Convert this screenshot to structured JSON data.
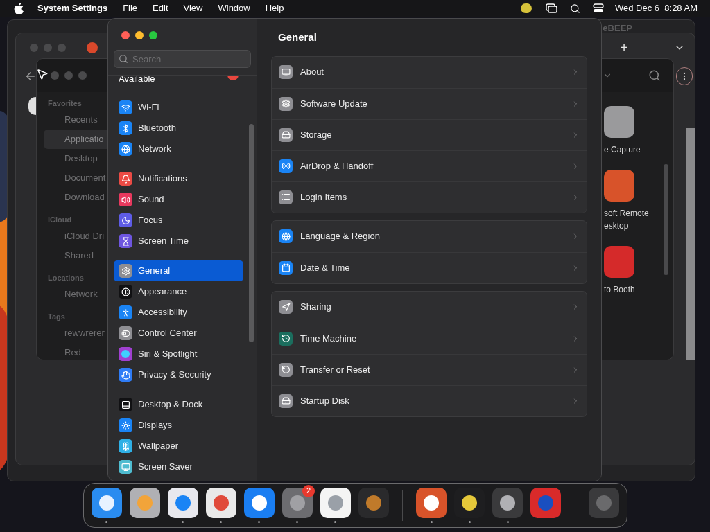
{
  "menu_bar": {
    "app": "System Settings",
    "menus": [
      "File",
      "Edit",
      "View",
      "Window",
      "Help"
    ],
    "clock": "Wed Dec 6  8:28 AM"
  },
  "back_window": {
    "title": "eBEEP",
    "tab_add": "+"
  },
  "finder": {
    "sidebar": [
      {
        "section": "Favorites",
        "items": [
          {
            "label": "Recents",
            "selected": false
          },
          {
            "label": "Applicatio",
            "selected": true
          },
          {
            "label": "Desktop",
            "selected": false
          },
          {
            "label": "Document",
            "selected": false
          },
          {
            "label": "Download",
            "selected": false
          }
        ]
      },
      {
        "section": "iCloud",
        "items": [
          {
            "label": "iCloud Dri",
            "selected": false
          },
          {
            "label": "Shared",
            "selected": false
          }
        ]
      },
      {
        "section": "Locations",
        "items": [
          {
            "label": "Network",
            "selected": false
          }
        ]
      },
      {
        "section": "Tags",
        "items": [
          {
            "label": "rewwrerer",
            "selected": false
          },
          {
            "label": "Red",
            "selected": false
          }
        ]
      }
    ],
    "apps": [
      {
        "label": "e Capture"
      },
      {
        "label": "soft Remote esktop"
      },
      {
        "label": "to Booth"
      }
    ]
  },
  "settings": {
    "search": {
      "placeholder": "Search"
    },
    "partial_item": "Available",
    "sidebar": [
      [
        {
          "label": "Wi-Fi",
          "color": "#1a84f5",
          "selected": false
        },
        {
          "label": "Bluetooth",
          "color": "#1a84f5",
          "selected": false
        },
        {
          "label": "Network",
          "color": "#1a84f5",
          "selected": false
        }
      ],
      [
        {
          "label": "Notifications",
          "color": "#eb4b45",
          "selected": false
        },
        {
          "label": "Sound",
          "color": "#e8395e",
          "selected": false
        },
        {
          "label": "Focus",
          "color": "#5e5ce6",
          "selected": false
        },
        {
          "label": "Screen Time",
          "color": "#6e56e0",
          "selected": false
        }
      ],
      [
        {
          "label": "General",
          "color": "#8e8e93",
          "selected": true
        },
        {
          "label": "Appearance",
          "color": "#111113",
          "selected": false
        },
        {
          "label": "Accessibility",
          "color": "#1a84f5",
          "selected": false
        },
        {
          "label": "Control Center",
          "color": "#8e8e93",
          "selected": false
        },
        {
          "label": "Siri & Spotlight",
          "color": "#a040d0",
          "selected": false
        },
        {
          "label": "Privacy & Security",
          "color": "#2f7cf6",
          "selected": false
        }
      ],
      [
        {
          "label": "Desktop & Dock",
          "color": "#111113",
          "selected": false
        },
        {
          "label": "Displays",
          "color": "#1a84f5",
          "selected": false
        },
        {
          "label": "Wallpaper",
          "color": "#2fb0e6",
          "selected": false
        },
        {
          "label": "Screen Saver",
          "color": "#4fbcd0",
          "selected": false
        }
      ]
    ],
    "title": "General",
    "groups": [
      [
        {
          "label": "About",
          "color": "#8e8e93"
        },
        {
          "label": "Software Update",
          "color": "#8e8e93"
        },
        {
          "label": "Storage",
          "color": "#8e8e93"
        },
        {
          "label": "AirDrop & Handoff",
          "color": "#1a84f5"
        },
        {
          "label": "Login Items",
          "color": "#8e8e93"
        }
      ],
      [
        {
          "label": "Language & Region",
          "color": "#1a84f5"
        },
        {
          "label": "Date & Time",
          "color": "#1a84f5"
        }
      ],
      [
        {
          "label": "Sharing",
          "color": "#8e8e93"
        },
        {
          "label": "Time Machine",
          "color": "#1b6e5e"
        },
        {
          "label": "Transfer or Reset",
          "color": "#8e8e93"
        },
        {
          "label": "Startup Disk",
          "color": "#8e8e93"
        }
      ]
    ]
  },
  "dock": {
    "groups": [
      [
        {
          "running": true
        },
        {
          "running": false
        },
        {
          "running": true
        },
        {
          "running": true
        },
        {
          "running": true
        },
        {
          "running": true,
          "badge": "2"
        },
        {
          "running": true
        },
        {
          "running": false
        }
      ],
      [
        {
          "running": true
        },
        {
          "running": true
        },
        {
          "running": true
        },
        {
          "running": false
        }
      ],
      [
        {
          "running": false
        }
      ]
    ]
  }
}
